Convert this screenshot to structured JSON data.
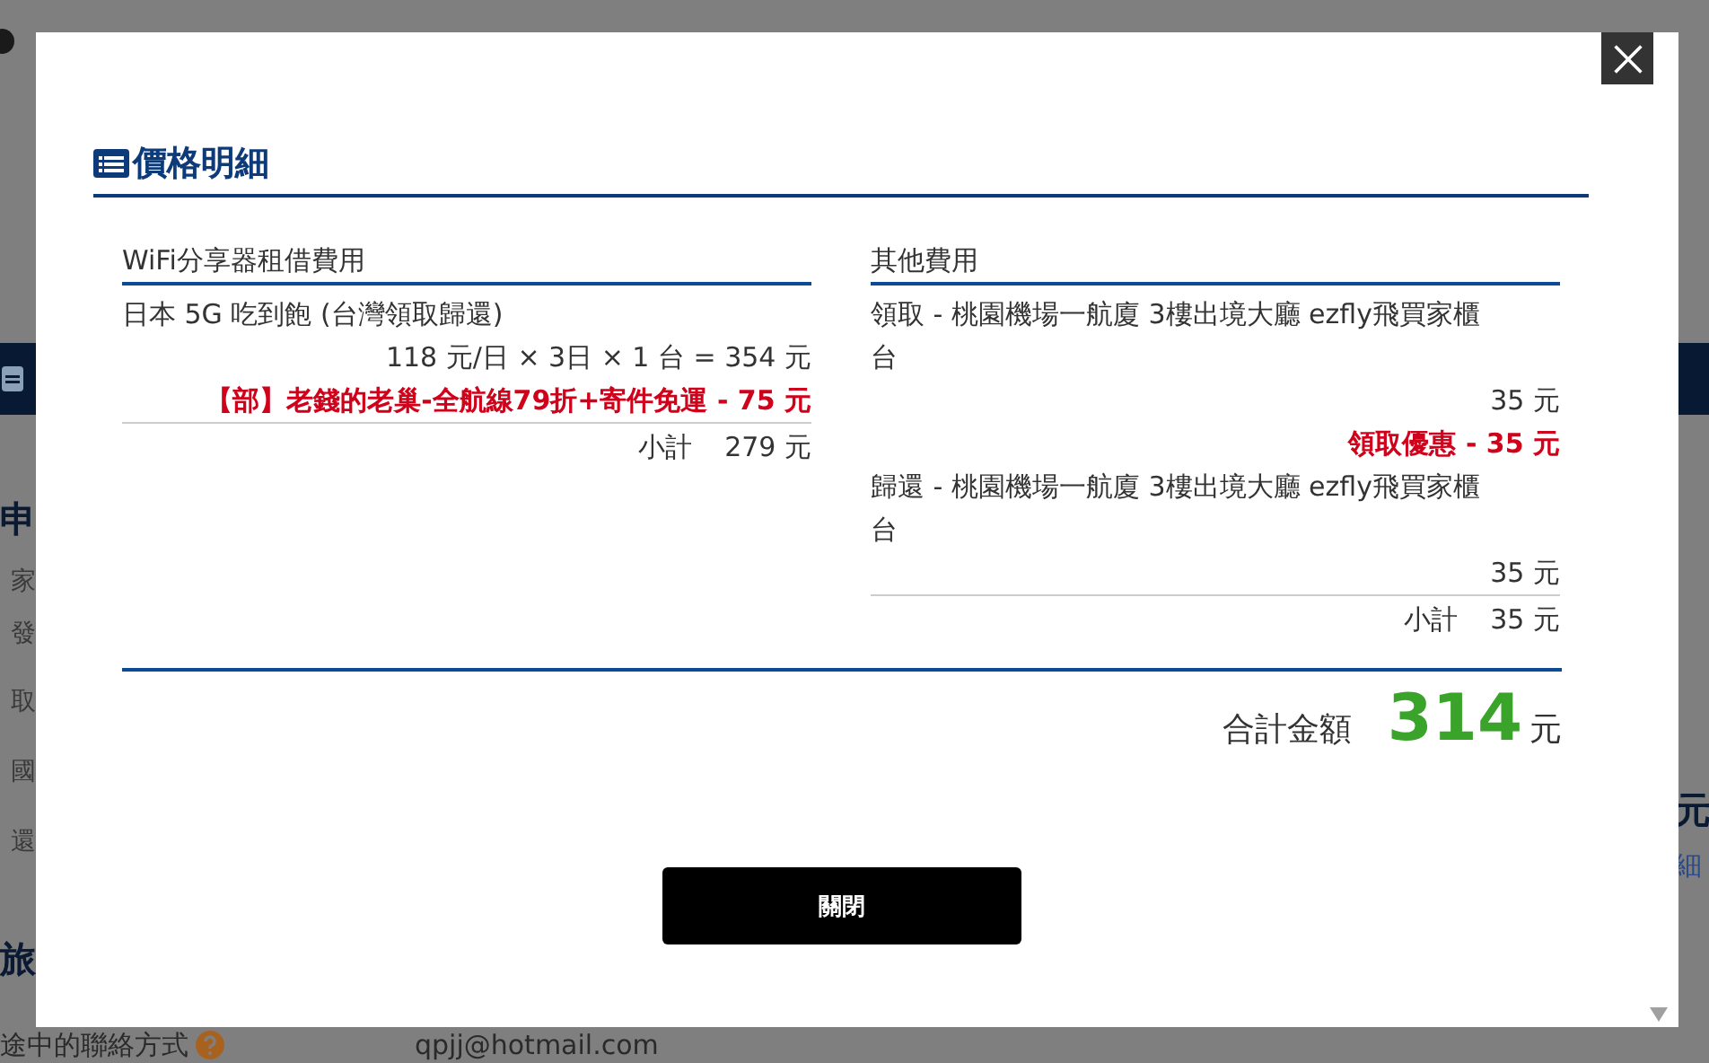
{
  "background": {
    "left_fragments": [
      {
        "kind": "heading",
        "text": "申"
      },
      {
        "kind": "row",
        "text": "家"
      },
      {
        "kind": "row",
        "text": "發"
      },
      {
        "kind": "row",
        "text": "取"
      },
      {
        "kind": "row",
        "text": "國"
      },
      {
        "kind": "row",
        "text": "還"
      },
      {
        "kind": "heading",
        "text": "旅"
      }
    ],
    "right_fragments": [
      {
        "kind": "heading",
        "text": "元"
      },
      {
        "kind": "link",
        "text": "細"
      }
    ],
    "contact_label": "途中的聯絡方式",
    "contact_value": "qpjj@hotmail.com"
  },
  "modal": {
    "title": "價格明細",
    "sections": [
      {
        "heading": "WiFi分享器租借費用",
        "items": [
          {
            "kind": "name",
            "text": "日本 5G 吃到飽 (台灣領取歸還)"
          },
          {
            "kind": "amount",
            "text": "118 元/日 × 3日 × 1 台 = 354 元"
          },
          {
            "kind": "discount",
            "text": "【部】老錢的老巢-全航線79折+寄件免運 - 75 元"
          }
        ],
        "subtotal_label": "小計",
        "subtotal_value": "279 元"
      },
      {
        "heading": "其他費用",
        "items": [
          {
            "kind": "name",
            "text": "領取 - 桃園機場一航廈 3樓出境大廳 ezfly飛買家櫃台"
          },
          {
            "kind": "amount",
            "text": "35 元"
          },
          {
            "kind": "discount",
            "text": "領取優惠 - 35 元"
          },
          {
            "kind": "name",
            "text": "歸還 - 桃園機場一航廈 3樓出境大廳 ezfly飛買家櫃台"
          },
          {
            "kind": "amount",
            "text": "35 元"
          }
        ],
        "subtotal_label": "小計",
        "subtotal_value": "35 元"
      }
    ],
    "total_label": "合計金額",
    "total_value": "314",
    "total_unit": "元",
    "close_button": "關閉"
  }
}
